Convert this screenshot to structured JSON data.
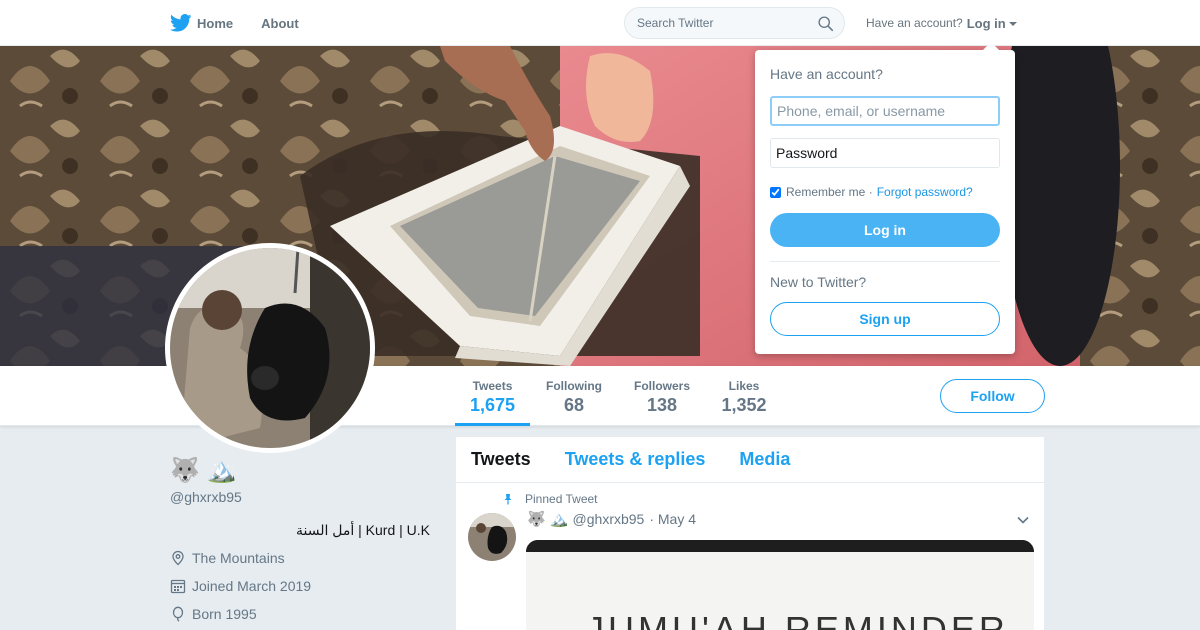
{
  "nav": {
    "home_label": "Home",
    "about_label": "About",
    "search_placeholder": "Search Twitter",
    "account_prompt": "Have an account?",
    "login_label": "Log in"
  },
  "profile_nav": {
    "stats": [
      {
        "label": "Tweets",
        "value": "1,675"
      },
      {
        "label": "Following",
        "value": "68"
      },
      {
        "label": "Followers",
        "value": "138"
      },
      {
        "label": "Likes",
        "value": "1,352"
      }
    ],
    "follow_label": "Follow"
  },
  "profile": {
    "name": "🐺 🏔️",
    "handle": "@ghxrxb95",
    "bio": "أمل السنة | Kurd | U.K",
    "location": "The Mountains",
    "joined": "Joined March 2019",
    "born": "Born 1995"
  },
  "timeline": {
    "tabs": [
      "Tweets",
      "Tweets & replies",
      "Media"
    ],
    "active_tab": "Tweets",
    "pinned_label": "Pinned Tweet",
    "tweet": {
      "name": "🐺 🏔️",
      "handle": "@ghxrxb95",
      "date": "· May 4",
      "media_text": "JUMU'AH REMINDER"
    }
  },
  "login_dropdown": {
    "title": "Have an account?",
    "username_placeholder": "Phone, email, or username",
    "password_placeholder": "Password",
    "remember_label": "Remember me ·",
    "remember_checked": true,
    "forgot_label": "Forgot password?",
    "login_button": "Log in",
    "new_prompt": "New to Twitter?",
    "signup_button": "Sign up"
  },
  "colors": {
    "accent": "#1da1f2",
    "login_button": "#4ab3f4",
    "background": "#e6ecf0"
  }
}
